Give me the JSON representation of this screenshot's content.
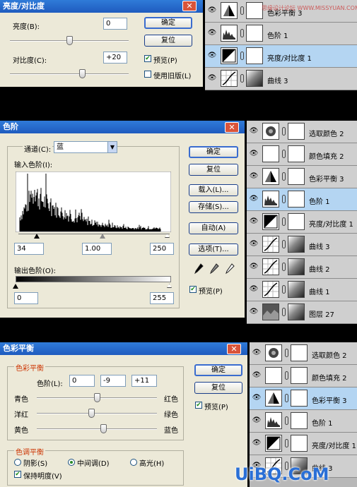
{
  "panel1": {
    "title": "亮度/对比度",
    "close_glyph": "✕",
    "brightness_label": "亮度(B):",
    "brightness_value": "0",
    "contrast_label": "对比度(C):",
    "contrast_value": "+20",
    "ok_label": "确定",
    "reset_label": "复位",
    "preview_label": "预览(P)",
    "preview_checked": true,
    "legacy_label": "使用旧版(L)",
    "legacy_checked": false,
    "layers": [
      {
        "name": "色彩平衡 3",
        "thumb": "balance",
        "selected": false
      },
      {
        "name": "色阶 1",
        "thumb": "levels",
        "selected": false
      },
      {
        "name": "亮度/对比度 1",
        "thumb": "brightness",
        "selected": true
      },
      {
        "name": "曲线 3",
        "thumb": "curves",
        "selected": false
      }
    ],
    "watermark": "思缘设计论坛 WWW.MISSYUAN.COM"
  },
  "panel2": {
    "title": "色阶",
    "close_glyph": "✕",
    "channel_label": "通道(C):",
    "channel_value": "蓝",
    "input_levels_label": "输入色阶(I):",
    "input_black": "34",
    "input_gamma": "1.00",
    "input_white": "250",
    "output_levels_label": "输出色阶(O):",
    "output_black": "0",
    "output_white": "255",
    "ok_label": "确定",
    "reset_label": "复位",
    "load_label": "载入(L)...",
    "save_label": "存储(S)...",
    "auto_label": "自动(A)",
    "options_label": "选项(T)...",
    "preview_label": "预览(P)",
    "preview_checked": true,
    "layers": [
      {
        "name": "选取颜色 2",
        "thumb": "selective",
        "selected": false
      },
      {
        "name": "颜色填充 2",
        "thumb": "fill",
        "selected": false
      },
      {
        "name": "色彩平衡 3",
        "thumb": "balance",
        "selected": false
      },
      {
        "name": "色阶 1",
        "thumb": "levels",
        "selected": true
      },
      {
        "name": "亮度/对比度 1",
        "thumb": "brightness",
        "selected": false
      },
      {
        "name": "曲线 3",
        "thumb": "curves",
        "selected": false
      },
      {
        "name": "曲线 2",
        "thumb": "curves",
        "selected": false
      },
      {
        "name": "曲线 1",
        "thumb": "curves",
        "selected": false
      },
      {
        "name": "图层 27",
        "thumb": "photo",
        "selected": false
      }
    ]
  },
  "panel3": {
    "title": "色彩平衡",
    "close_glyph": "✕",
    "balance_group_label": "色彩平衡",
    "levels_label": "色阶(L):",
    "level1": "0",
    "level2": "-9",
    "level3": "+11",
    "cyan_label": "青色",
    "red_label": "红色",
    "magenta_label": "洋红",
    "green_label": "绿色",
    "yellow_label": "黄色",
    "blue_label": "蓝色",
    "slider1": 0,
    "slider2": -9,
    "slider3": 11,
    "tone_group_label": "色调平衡",
    "shadows_label": "阴影(S)",
    "midtones_label": "中间调(D)",
    "highlights_label": "高光(H)",
    "tone_selected": "midtones",
    "preserve_label": "保持明度(V)",
    "preserve_checked": true,
    "ok_label": "确定",
    "reset_label": "复位",
    "preview_label": "预览(P)",
    "preview_checked": true,
    "layers": [
      {
        "name": "选取颜色 2",
        "thumb": "selective",
        "selected": false
      },
      {
        "name": "颜色填充 2",
        "thumb": "fill",
        "selected": false
      },
      {
        "name": "色彩平衡 3",
        "thumb": "balance",
        "selected": true
      },
      {
        "name": "色阶 1",
        "thumb": "levels",
        "selected": false
      },
      {
        "name": "亮度/对比度 1",
        "thumb": "brightness",
        "selected": false
      },
      {
        "name": "曲线 3",
        "thumb": "curves",
        "selected": false
      }
    ],
    "logo_text": "UiBQ.CoM"
  }
}
